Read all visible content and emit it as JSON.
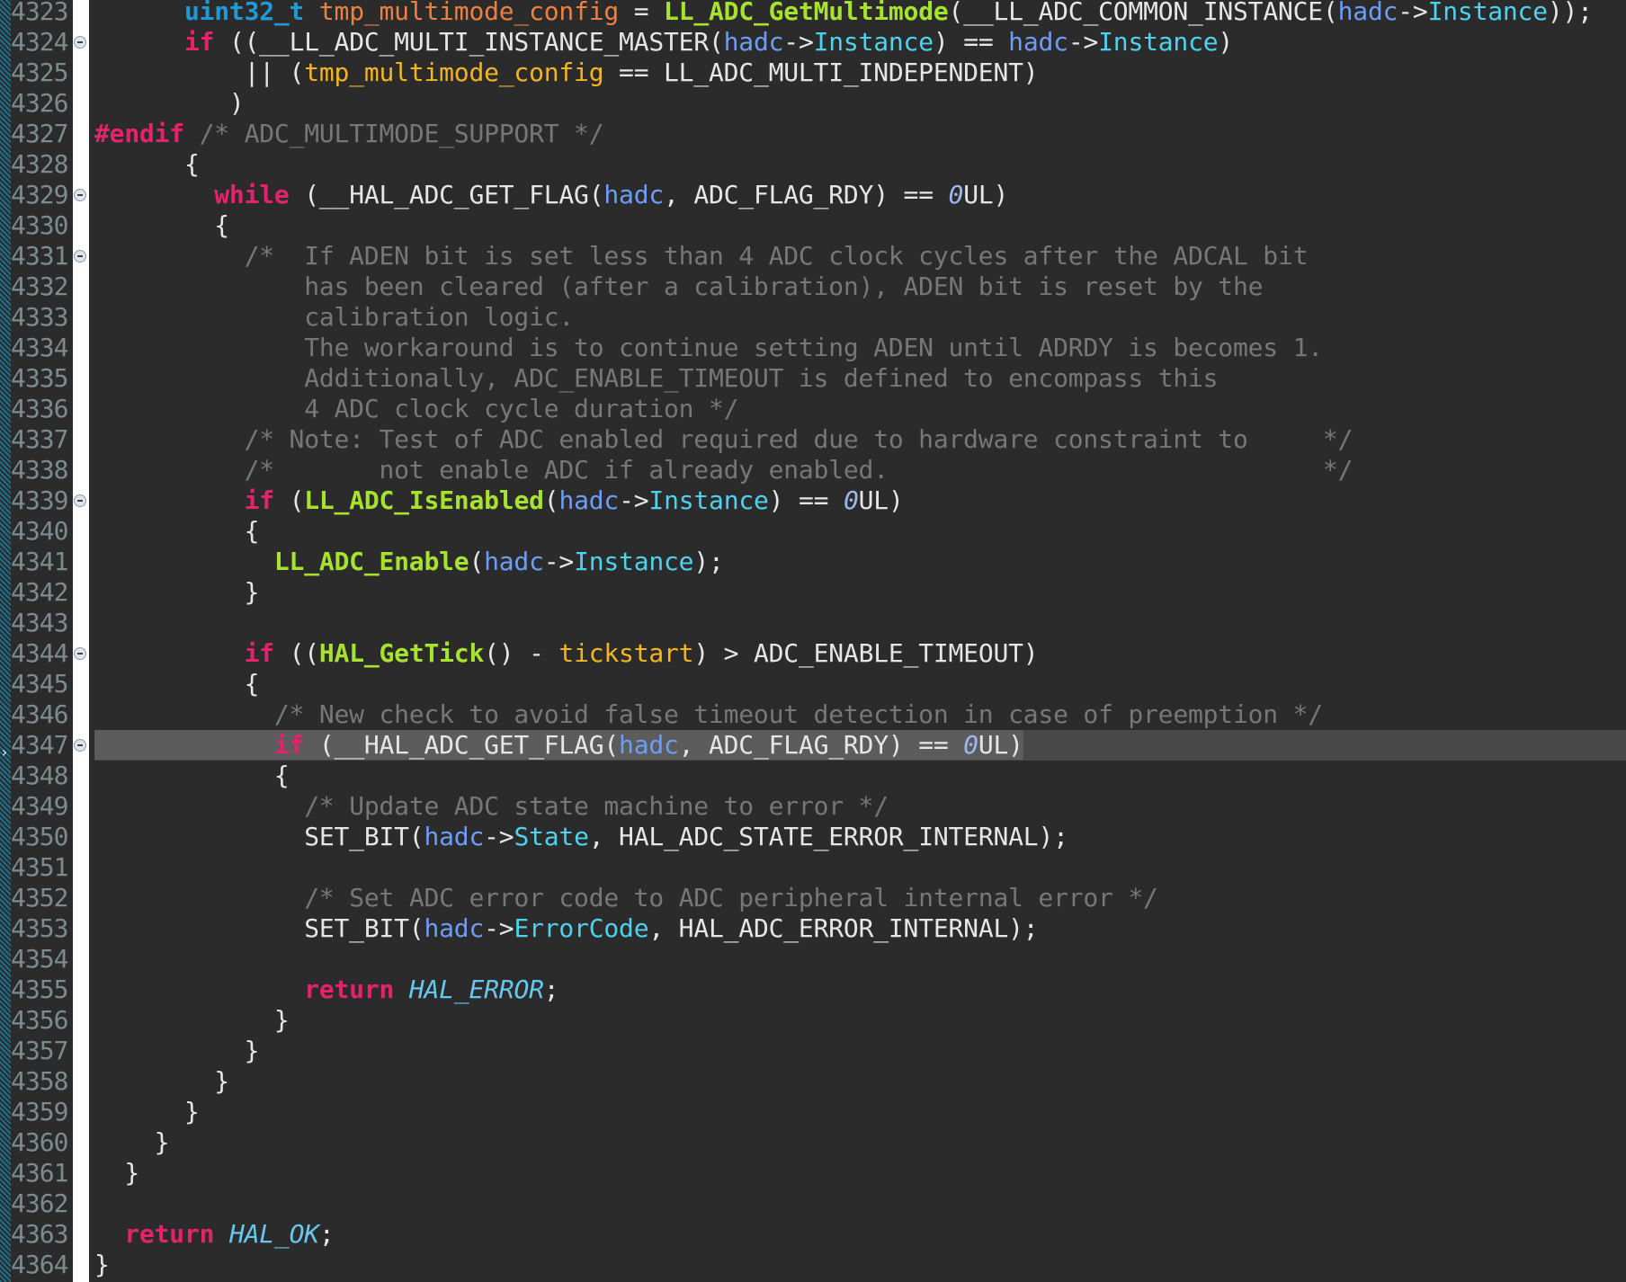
{
  "editor": {
    "current_line": "4347",
    "lines": [
      {
        "n": "4323",
        "fold": false,
        "tokens": [
          [
            "p",
            "      "
          ],
          [
            "type",
            "uint32_t"
          ],
          [
            "p",
            " "
          ],
          [
            "var",
            "tmp_multimode_config"
          ],
          [
            "p",
            " = "
          ],
          [
            "fn",
            "LL_ADC_GetMultimode"
          ],
          [
            "p",
            "(__LL_ADC_COMMON_INSTANCE("
          ],
          [
            "par",
            "hadc"
          ],
          [
            "p",
            "->"
          ],
          [
            "mem",
            "Instance"
          ],
          [
            "p",
            "));"
          ]
        ]
      },
      {
        "n": "4324",
        "fold": true,
        "tokens": [
          [
            "p",
            "      "
          ],
          [
            "kw",
            "if"
          ],
          [
            "p",
            " ((__LL_ADC_MULTI_INSTANCE_MASTER("
          ],
          [
            "par",
            "hadc"
          ],
          [
            "p",
            "->"
          ],
          [
            "mem",
            "Instance"
          ],
          [
            "p",
            ") == "
          ],
          [
            "par",
            "hadc"
          ],
          [
            "p",
            "->"
          ],
          [
            "mem",
            "Instance"
          ],
          [
            "p",
            ")"
          ]
        ]
      },
      {
        "n": "4325",
        "fold": false,
        "tokens": [
          [
            "p",
            "          || ("
          ],
          [
            "var2",
            "tmp_multimode_config"
          ],
          [
            "p",
            " == LL_ADC_MULTI_INDEPENDENT)"
          ]
        ]
      },
      {
        "n": "4326",
        "fold": false,
        "tokens": [
          [
            "p",
            "         )"
          ]
        ]
      },
      {
        "n": "4327",
        "fold": false,
        "tokens": [
          [
            "pp",
            "#endif"
          ],
          [
            "p",
            " "
          ],
          [
            "cm",
            "/* ADC_MULTIMODE_SUPPORT */"
          ]
        ]
      },
      {
        "n": "4328",
        "fold": false,
        "tokens": [
          [
            "p",
            "      {"
          ]
        ]
      },
      {
        "n": "4329",
        "fold": true,
        "tokens": [
          [
            "p",
            "        "
          ],
          [
            "kw",
            "while"
          ],
          [
            "p",
            " (__HAL_ADC_GET_FLAG("
          ],
          [
            "par",
            "hadc"
          ],
          [
            "p",
            ", ADC_FLAG_RDY) == "
          ],
          [
            "num0",
            "0"
          ],
          [
            "p",
            "UL)"
          ]
        ]
      },
      {
        "n": "4330",
        "fold": false,
        "tokens": [
          [
            "p",
            "        {"
          ]
        ]
      },
      {
        "n": "4331",
        "fold": true,
        "tokens": [
          [
            "p",
            "          "
          ],
          [
            "cm",
            "/*  If ADEN bit is set less than 4 ADC clock cycles after the ADCAL bit"
          ]
        ]
      },
      {
        "n": "4332",
        "fold": false,
        "tokens": [
          [
            "cm",
            "              has been cleared (after a calibration), ADEN bit is reset by the"
          ]
        ]
      },
      {
        "n": "4333",
        "fold": false,
        "tokens": [
          [
            "cm",
            "              calibration logic."
          ]
        ]
      },
      {
        "n": "4334",
        "fold": false,
        "tokens": [
          [
            "cm",
            "              The workaround is to continue setting ADEN until ADRDY is becomes 1."
          ]
        ]
      },
      {
        "n": "4335",
        "fold": false,
        "tokens": [
          [
            "cm",
            "              Additionally, ADC_ENABLE_TIMEOUT is defined to encompass this"
          ]
        ]
      },
      {
        "n": "4336",
        "fold": false,
        "tokens": [
          [
            "cm",
            "              4 ADC clock cycle duration */"
          ]
        ]
      },
      {
        "n": "4337",
        "fold": false,
        "tokens": [
          [
            "p",
            "          "
          ],
          [
            "cm",
            "/* Note: Test of ADC enabled required due to hardware constraint to     */"
          ]
        ]
      },
      {
        "n": "4338",
        "fold": false,
        "tokens": [
          [
            "p",
            "          "
          ],
          [
            "cm",
            "/*       not enable ADC if already enabled.                             */"
          ]
        ]
      },
      {
        "n": "4339",
        "fold": true,
        "tokens": [
          [
            "p",
            "          "
          ],
          [
            "kw",
            "if"
          ],
          [
            "p",
            " ("
          ],
          [
            "fn",
            "LL_ADC_IsEnabled"
          ],
          [
            "p",
            "("
          ],
          [
            "par",
            "hadc"
          ],
          [
            "p",
            "->"
          ],
          [
            "mem",
            "Instance"
          ],
          [
            "p",
            ") == "
          ],
          [
            "num0",
            "0"
          ],
          [
            "p",
            "UL)"
          ]
        ]
      },
      {
        "n": "4340",
        "fold": false,
        "tokens": [
          [
            "p",
            "          {"
          ]
        ]
      },
      {
        "n": "4341",
        "fold": false,
        "tokens": [
          [
            "p",
            "            "
          ],
          [
            "fn",
            "LL_ADC_Enable"
          ],
          [
            "p",
            "("
          ],
          [
            "par",
            "hadc"
          ],
          [
            "p",
            "->"
          ],
          [
            "mem",
            "Instance"
          ],
          [
            "p",
            ");"
          ]
        ]
      },
      {
        "n": "4342",
        "fold": false,
        "tokens": [
          [
            "p",
            "          }"
          ]
        ]
      },
      {
        "n": "4343",
        "fold": false,
        "tokens": []
      },
      {
        "n": "4344",
        "fold": true,
        "tokens": [
          [
            "p",
            "          "
          ],
          [
            "kw",
            "if"
          ],
          [
            "p",
            " (("
          ],
          [
            "fn",
            "HAL_GetTick"
          ],
          [
            "p",
            "() - "
          ],
          [
            "var2",
            "tickstart"
          ],
          [
            "p",
            ") > ADC_ENABLE_TIMEOUT)"
          ]
        ]
      },
      {
        "n": "4345",
        "fold": false,
        "tokens": [
          [
            "p",
            "          {"
          ]
        ]
      },
      {
        "n": "4346",
        "fold": false,
        "tokens": [
          [
            "p",
            "            "
          ],
          [
            "cm",
            "/* New check to avoid false timeout detection in case of preemption */"
          ]
        ]
      },
      {
        "n": "4347",
        "fold": true,
        "tokens": [
          [
            "p",
            "            "
          ],
          [
            "kw",
            "if"
          ],
          [
            "p",
            " (__HAL_ADC_GET_FLAG("
          ],
          [
            "par",
            "hadc"
          ],
          [
            "p",
            ", ADC_FLAG_RDY) == "
          ],
          [
            "num0",
            "0"
          ],
          [
            "p",
            "UL)"
          ]
        ]
      },
      {
        "n": "4348",
        "fold": false,
        "tokens": [
          [
            "p",
            "            {"
          ]
        ]
      },
      {
        "n": "4349",
        "fold": false,
        "tokens": [
          [
            "p",
            "              "
          ],
          [
            "cm",
            "/* Update ADC state machine to error */"
          ]
        ]
      },
      {
        "n": "4350",
        "fold": false,
        "tokens": [
          [
            "p",
            "              SET_BIT("
          ],
          [
            "par",
            "hadc"
          ],
          [
            "p",
            "->"
          ],
          [
            "mem",
            "State"
          ],
          [
            "p",
            ", HAL_ADC_STATE_ERROR_INTERNAL);"
          ]
        ]
      },
      {
        "n": "4351",
        "fold": false,
        "tokens": []
      },
      {
        "n": "4352",
        "fold": false,
        "tokens": [
          [
            "p",
            "              "
          ],
          [
            "cm",
            "/* Set ADC error code to ADC peripheral internal error */"
          ]
        ]
      },
      {
        "n": "4353",
        "fold": false,
        "tokens": [
          [
            "p",
            "              SET_BIT("
          ],
          [
            "par",
            "hadc"
          ],
          [
            "p",
            "->"
          ],
          [
            "mem",
            "ErrorCode"
          ],
          [
            "p",
            ", HAL_ADC_ERROR_INTERNAL);"
          ]
        ]
      },
      {
        "n": "4354",
        "fold": false,
        "tokens": []
      },
      {
        "n": "4355",
        "fold": false,
        "tokens": [
          [
            "p",
            "              "
          ],
          [
            "kw",
            "return"
          ],
          [
            "p",
            " "
          ],
          [
            "const",
            "HAL_ERROR"
          ],
          [
            "p",
            ";"
          ]
        ]
      },
      {
        "n": "4356",
        "fold": false,
        "tokens": [
          [
            "p",
            "            }"
          ]
        ]
      },
      {
        "n": "4357",
        "fold": false,
        "tokens": [
          [
            "p",
            "          }"
          ]
        ]
      },
      {
        "n": "4358",
        "fold": false,
        "tokens": [
          [
            "p",
            "        }"
          ]
        ]
      },
      {
        "n": "4359",
        "fold": false,
        "tokens": [
          [
            "p",
            "      }"
          ]
        ]
      },
      {
        "n": "4360",
        "fold": false,
        "tokens": [
          [
            "p",
            "    }"
          ]
        ]
      },
      {
        "n": "4361",
        "fold": false,
        "tokens": [
          [
            "p",
            "  }"
          ]
        ]
      },
      {
        "n": "4362",
        "fold": false,
        "tokens": []
      },
      {
        "n": "4363",
        "fold": false,
        "tokens": [
          [
            "p",
            "  "
          ],
          [
            "kw",
            "return"
          ],
          [
            "p",
            " "
          ],
          [
            "const",
            "HAL_OK"
          ],
          [
            "p",
            ";"
          ]
        ]
      },
      {
        "n": "4364",
        "fold": false,
        "tokens": [
          [
            "p",
            "}"
          ]
        ]
      }
    ]
  }
}
